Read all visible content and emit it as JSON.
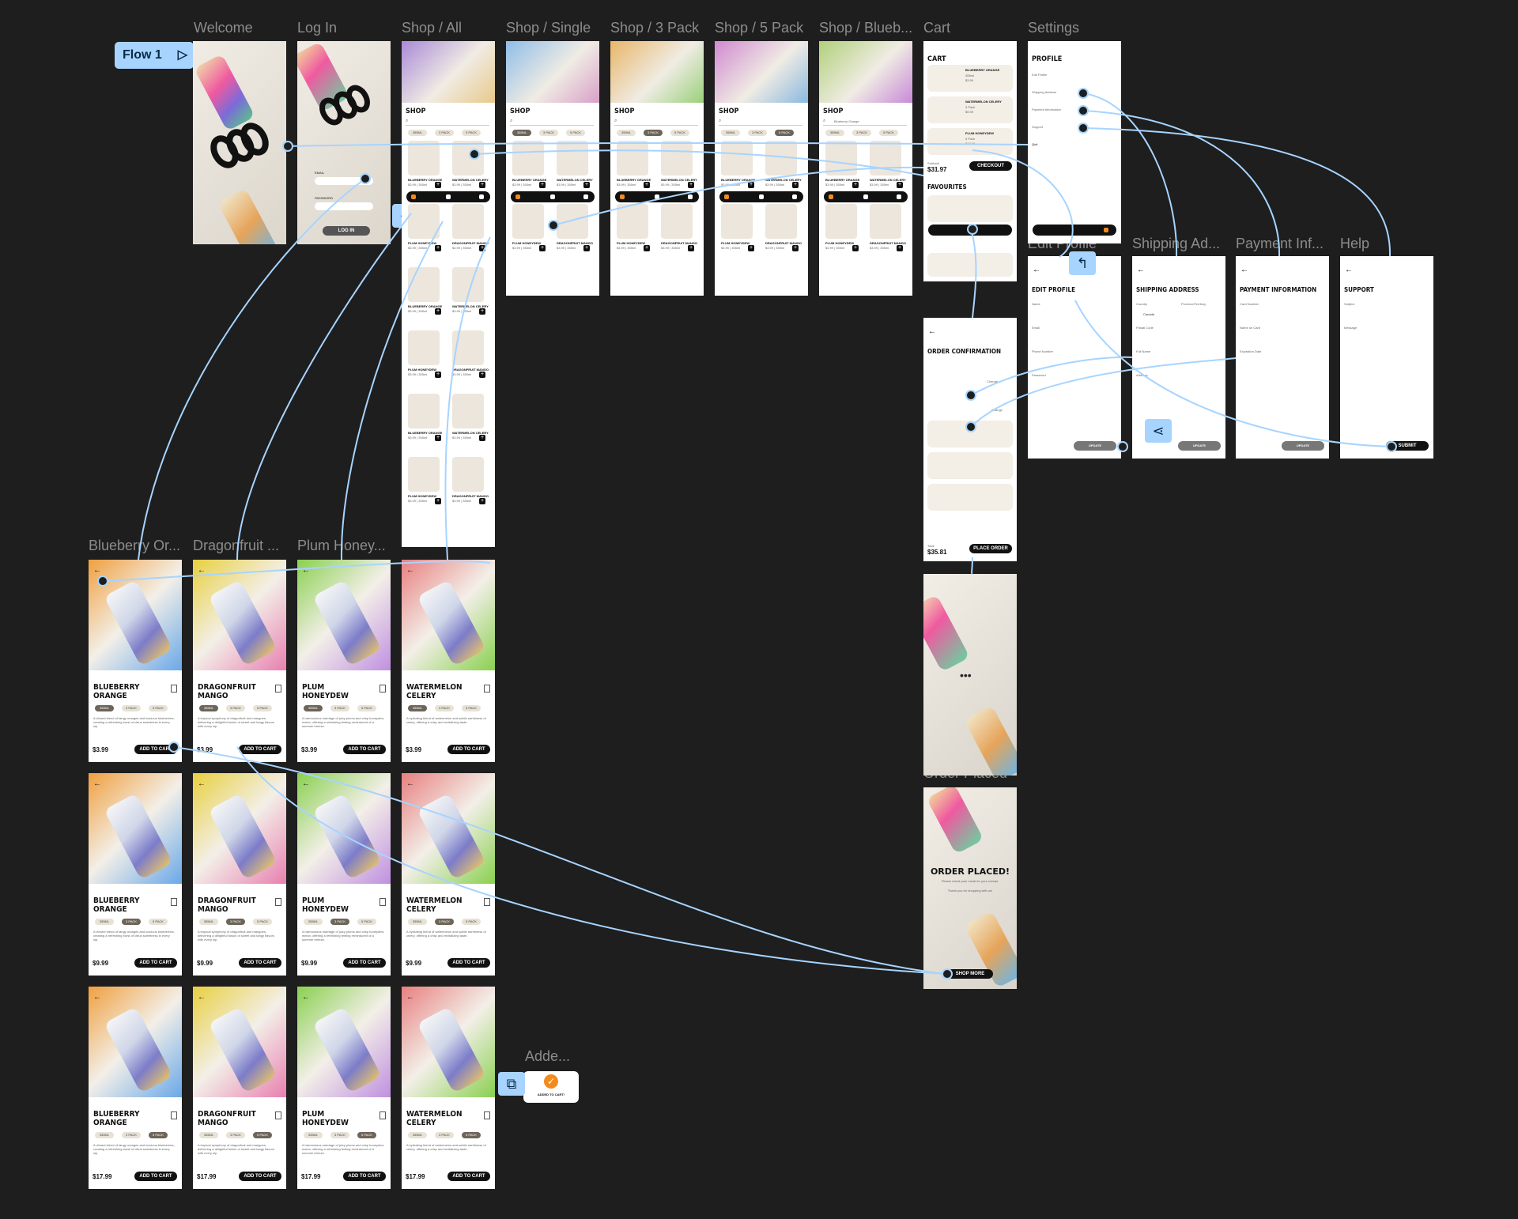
{
  "flow": {
    "label": "Flow 1"
  },
  "labels": {
    "welcome": "Welcome",
    "login": "Log In",
    "shop_all": "Shop / All",
    "shop_single": "Shop / Single",
    "shop_3": "Shop / 3 Pack",
    "shop_5": "Shop / 5 Pack",
    "shop_blue": "Shop / Blueb...",
    "cart": "Cart",
    "settings": "Settings",
    "edit_profile": "Edit Profile",
    "shipping": "Shipping Ad...",
    "payment": "Payment Inf...",
    "help": "Help",
    "blueberry": "Blueberry Or...",
    "dragonfruit": "Dragonfruit ...",
    "plum": "Plum Honey...",
    "added": "Adde...",
    "order_placed": "Order Placed"
  },
  "login": {
    "email": "EMAIL",
    "password": "PASSWORD",
    "button": "LOG IN"
  },
  "shop": {
    "title": "SHOP",
    "search_value": "Blueberry Orange",
    "filters": [
      "355ML",
      "3 PACK",
      "5 PACK"
    ]
  },
  "shop_items": [
    {
      "name": "BLUEBERRY ORANGE",
      "sub": "$3.99 | 355ml"
    },
    {
      "name": "WATERMELON CELERY",
      "sub": "$3.99 | 355ml"
    },
    {
      "name": "PLUM HONEYDEW",
      "sub": "$3.99 | 355ml"
    },
    {
      "name": "DRAGONFRUIT MANGO",
      "sub": "$3.99 | 355ml"
    }
  ],
  "cart": {
    "title": "CART",
    "items": [
      {
        "name": "BLUEBERRY ORANGE",
        "detail": "355ml",
        "price": "$3.99"
      },
      {
        "name": "WATERMELON CELERY",
        "detail": "3 Pack",
        "price": "$9.99"
      },
      {
        "name": "PLUM HONEYDEW",
        "detail": "5 Pack",
        "price": "$17.99"
      }
    ],
    "subtotal_label": "Subtotal",
    "subtotal": "$31.97",
    "checkout": "CHECKOUT",
    "favourites": "FAVOURITES"
  },
  "profile": {
    "title": "PROFILE",
    "items": [
      "Edit Profile",
      "Shipping Address",
      "Payment Information",
      "Support",
      "Quit"
    ]
  },
  "edit_profile": {
    "title": "EDIT PROFILE",
    "fields": [
      "Name",
      "Email",
      "Phone Number",
      "Password"
    ],
    "button": "UPDATE"
  },
  "shipping_addr": {
    "title": "SHIPPING ADDRESS",
    "fields": [
      "Country",
      "Province/Territory",
      "Postal Code",
      "Full Name",
      "Address"
    ],
    "country": "Canada",
    "button": "UPDATE"
  },
  "payment": {
    "title": "PAYMENT INFORMATION",
    "fields": [
      "Card Number",
      "Name on Card",
      "Expiration Date"
    ],
    "button": "UPDATE"
  },
  "support": {
    "title": "SUPPORT",
    "fields": [
      "Subject",
      "Message"
    ],
    "button": "SUBMIT"
  },
  "order_conf": {
    "title": "ORDER CONFIRMATION",
    "total_label": "Total",
    "total": "$35.81",
    "button": "PLACE ORDER",
    "change": "Change"
  },
  "order_placed": {
    "title": "ORDER PLACED!",
    "sub": "Please check your email for your receipt.",
    "thanks": "Thank you for shopping with us!",
    "button": "SHOP MORE"
  },
  "products": [
    {
      "name1": "BLUEBERRY",
      "name2": "ORANGE",
      "desc": "A vibrant blend of tangy oranges and luscious blueberries, creating a refreshing burst of citrus sweetness in every sip."
    },
    {
      "name1": "DRAGONFRUIT",
      "name2": "MANGO",
      "desc": "A tropical symphony of dragonfruit and mangoes, delivering a delightful fusion of sweet and tangy flavors with every sip."
    },
    {
      "name1": "PLUM",
      "name2": "HONEYDEW",
      "desc": "A harmonious marriage of juicy plums and crisp honeydew melon, offering a refreshing feeling reminiscent of a summer breeze."
    },
    {
      "name1": "WATERMELON",
      "name2": "CELERY",
      "desc": "A hydrating blend of watermelon and subtle earthiness of celery, offering a crisp and revitalizing taste."
    }
  ],
  "product_rows": [
    {
      "price": "$3.99",
      "active": 0
    },
    {
      "price": "$9.99",
      "active": 1
    },
    {
      "price": "$17.99",
      "active": 2
    }
  ],
  "detail": {
    "pills": [
      "355ML",
      "3 PACK",
      "5 PACK"
    ],
    "add_to_cart": "ADD TO CART"
  },
  "added_toast": "ADDED TO CART!",
  "colors": {
    "accent": "#a7d4ff",
    "canvas": "#1e1e1e",
    "nav": "#f28b1e"
  }
}
